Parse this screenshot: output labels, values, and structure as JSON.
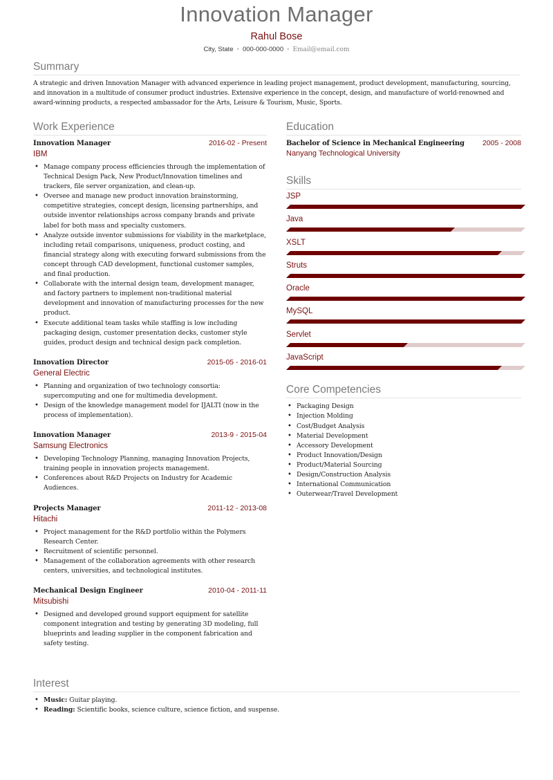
{
  "header": {
    "title": "Innovation Manager",
    "name": "Rahul Bose",
    "location": "City, State",
    "phone": "000-000-0000",
    "email": "Email@email.com"
  },
  "colors": {
    "accent": "#7a0f0f",
    "skill_fill": "#6e0000",
    "skill_track": "#e0cbcb",
    "heading_gray": "#7b7b7b"
  },
  "summary": {
    "heading": "Summary",
    "text": "A strategic and driven Innovation Manager with advanced experience in leading project management, product development, manufacturing, sourcing, and innovation in a multitude of consumer product industries. Extensive experience in the concept, design, and manufacture of world-renowned and award-winning products, a respected ambassador for the Arts, Leisure & Tourism, Music, Sports."
  },
  "work": {
    "heading": "Work Experience",
    "jobs": [
      {
        "title": "Innovation Manager",
        "dates": "2016-02 - Present",
        "company": "IBM",
        "bullets": [
          "Manage company process efficiencies through the implementation of Technical Design Pack, New Product/Innovation timelines and trackers, file server organization, and clean-up.",
          "Oversee and manage new product innovation brainstorming, competitive strategies, concept design, licensing partnerships, and outside inventor relationships across company brands and private label for both mass and specialty customers.",
          "Analyze outside inventor submissions for viability in the marketplace, including retail comparisons, uniqueness, product costing, and financial strategy along with executing forward submissions from the concept through CAD development, functional customer samples, and final production.",
          "Collaborate with the internal design team, development manager, and factory partners to implement non-traditional material development and innovation of manufacturing processes for the new product.",
          "Execute additional team tasks while staffing is low including packaging design, customer presentation decks, customer style guides, product design and technical design pack completion."
        ]
      },
      {
        "title": "Innovation Director",
        "dates": "2015-05 - 2016-01",
        "company": "General Electric",
        "bullets": [
          "Planning and organization of two technology consortia: supercomputing and one for multimedia development.",
          "Design of the knowledge management model for IJALTI (now in the process of implementation)."
        ]
      },
      {
        "title": "Innovation Manager",
        "dates": "2013-9 - 2015-04",
        "company": "Samsung Electronics",
        "bullets": [
          "Developing Technology Planning, managing Innovation Projects, training people in innovation projects management.",
          "Conferences about R&D Projects on Industry for Academic Audiences."
        ]
      },
      {
        "title": "Projects Manager",
        "dates": "2011-12 - 2013-08",
        "company": "Hitachi",
        "bullets": [
          "Project management for the R&D portfolio within the Polymers Research Center.",
          "Recruitment of scientific personnel.",
          "Management of the collaboration agreements with other research centers, universities, and technological institutes."
        ]
      },
      {
        "title": "Mechanical Design Engineer",
        "dates": "2010-04 - 2011-11",
        "company": "Mitsubishi",
        "bullets": [
          "Designed and developed ground support equipment for satellite component integration and testing by generating 3D modeling, full blueprints and leading supplier in the component fabrication and safety testing."
        ]
      }
    ]
  },
  "education": {
    "heading": "Education",
    "degree": "Bachelor of Science in Mechanical Engineering",
    "dates": "2005 - 2008",
    "school": "Nanyang Technological University"
  },
  "skills": {
    "heading": "Skills",
    "items": [
      {
        "name": "JSP",
        "level_percent": 100
      },
      {
        "name": "Java",
        "level_percent": 70
      },
      {
        "name": "XSLT",
        "level_percent": 90
      },
      {
        "name": "Struts",
        "level_percent": 100
      },
      {
        "name": "Oracle",
        "level_percent": 100
      },
      {
        "name": "MySQL",
        "level_percent": 100
      },
      {
        "name": "Servlet",
        "level_percent": 50
      },
      {
        "name": "JavaScript",
        "level_percent": 90
      }
    ]
  },
  "competencies": {
    "heading": "Core Competencies",
    "items": [
      "Packaging Design",
      "Injection Molding",
      "Cost/Budget Analysis",
      "Material Development",
      "Accessory Development",
      "Product Innovation/Design",
      "Product/Material Sourcing",
      "Design/Construction Analysis",
      "International Communication",
      "Outerwear/Travel Development"
    ]
  },
  "interest": {
    "heading": "Interest",
    "items": [
      {
        "label": "Music:",
        "text": " Guitar playing."
      },
      {
        "label": "Reading:",
        "text": " Scientific books, science culture, science fiction, and suspense."
      }
    ]
  }
}
